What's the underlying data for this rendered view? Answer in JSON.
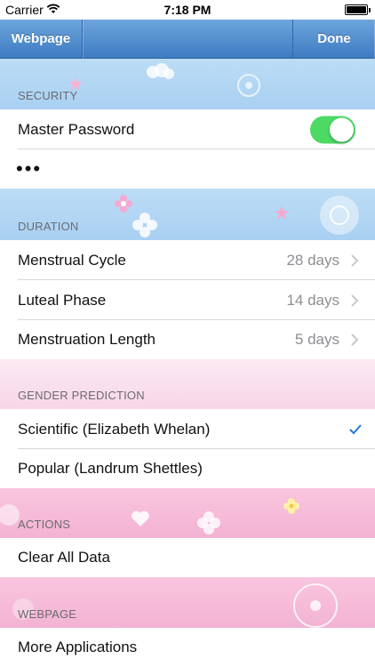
{
  "status": {
    "carrier": "Carrier",
    "time": "7:18 PM"
  },
  "nav": {
    "left": "Webpage",
    "right": "Done"
  },
  "security": {
    "header": "SECURITY",
    "master_password_label": "Master Password",
    "toggle_on": true,
    "password_mask": "•••"
  },
  "duration": {
    "header": "DURATION",
    "rows": [
      {
        "label": "Menstrual Cycle",
        "value": "28 days"
      },
      {
        "label": "Luteal Phase",
        "value": "14 days"
      },
      {
        "label": "Menstruation Length",
        "value": "5 days"
      }
    ]
  },
  "gender": {
    "header": "GENDER PREDICTION",
    "rows": [
      {
        "label": "Scientific (Elizabeth Whelan)",
        "checked": true
      },
      {
        "label": "Popular (Landrum Shettles)",
        "checked": false
      }
    ]
  },
  "actions": {
    "header": "ACTIONS",
    "clear_label": "Clear All Data"
  },
  "webpage": {
    "header": "WEBPAGE",
    "more_label": "More Applications"
  },
  "colors": {
    "toggle_on": "#4cd964",
    "accent": "#1f7ad6",
    "nav": "#3d7bc2"
  }
}
